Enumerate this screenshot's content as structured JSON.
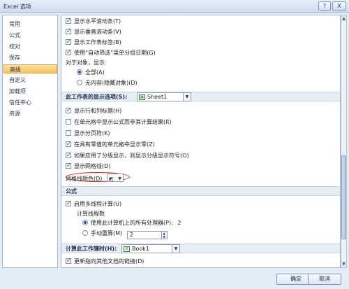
{
  "window": {
    "title": "Excel 选项",
    "help_label": "?",
    "close_label": "X"
  },
  "sidebar": {
    "items": [
      {
        "label": "常用",
        "active": false
      },
      {
        "label": "公式",
        "active": false
      },
      {
        "label": "校对",
        "active": false
      },
      {
        "label": "保存",
        "active": false
      },
      {
        "label": "高级",
        "active": true
      },
      {
        "label": "自定义",
        "active": false
      },
      {
        "label": "加载项",
        "active": false
      },
      {
        "label": "信任中心",
        "active": false
      },
      {
        "label": "资源",
        "active": false
      }
    ]
  },
  "content": {
    "display_options": {
      "show_hscroll": {
        "label": "显示水平滚动条(T)",
        "checked": true
      },
      "show_vscroll": {
        "label": "显示垂直滚动条(V)",
        "checked": true
      },
      "show_sheet_tabs": {
        "label": "显示工作表标签(B)",
        "checked": true
      },
      "group_dates": {
        "label": "使用“自动筛选”菜单分组日期(G)",
        "checked": true
      },
      "objects_label": "对于对象，显示:",
      "objects_all": {
        "label": "全部(A)",
        "selected": true
      },
      "objects_none": {
        "label": "无内容(隐藏对象)(D)",
        "selected": false
      }
    },
    "sheet_section": {
      "title": "此工作表的显示选项(S):",
      "sheet_value": "Sheet1",
      "show_headers": {
        "label": "显示行和列标题(H)",
        "checked": true
      },
      "show_formulas": {
        "label": "在单元格中显示公式而非其计算结果(R)",
        "checked": false
      },
      "show_page_breaks": {
        "label": "显示分页符(K)",
        "checked": false
      },
      "show_zero": {
        "label": "在具有零值的单元格中显示零(Z)",
        "checked": true
      },
      "show_outline": {
        "label": "如果应用了分级显示，则显示分级显示符号(O)",
        "checked": true
      },
      "show_gridlines": {
        "label": "显示网格线(D)",
        "checked": true
      },
      "gridline_color_label": "网格线颜色(D)"
    },
    "formulas_section": {
      "title": "公式",
      "multithread": {
        "label": "启用多线程计算(U)",
        "checked": true
      },
      "threads_label": "计算线程数",
      "use_all_processors": {
        "label": "使用此计算机上的所有处理器(P):",
        "selected": true,
        "value": "2"
      },
      "manual": {
        "label": "手动重算(M)",
        "selected": false,
        "value": "2"
      }
    },
    "calc_section": {
      "title": "计算此工作簿时(H):",
      "book_value": "Book1",
      "update_links": {
        "label": "更新指向其他文档的链接(D)",
        "checked": true
      }
    }
  },
  "buttons": {
    "ok": "确定",
    "cancel": "取消"
  }
}
